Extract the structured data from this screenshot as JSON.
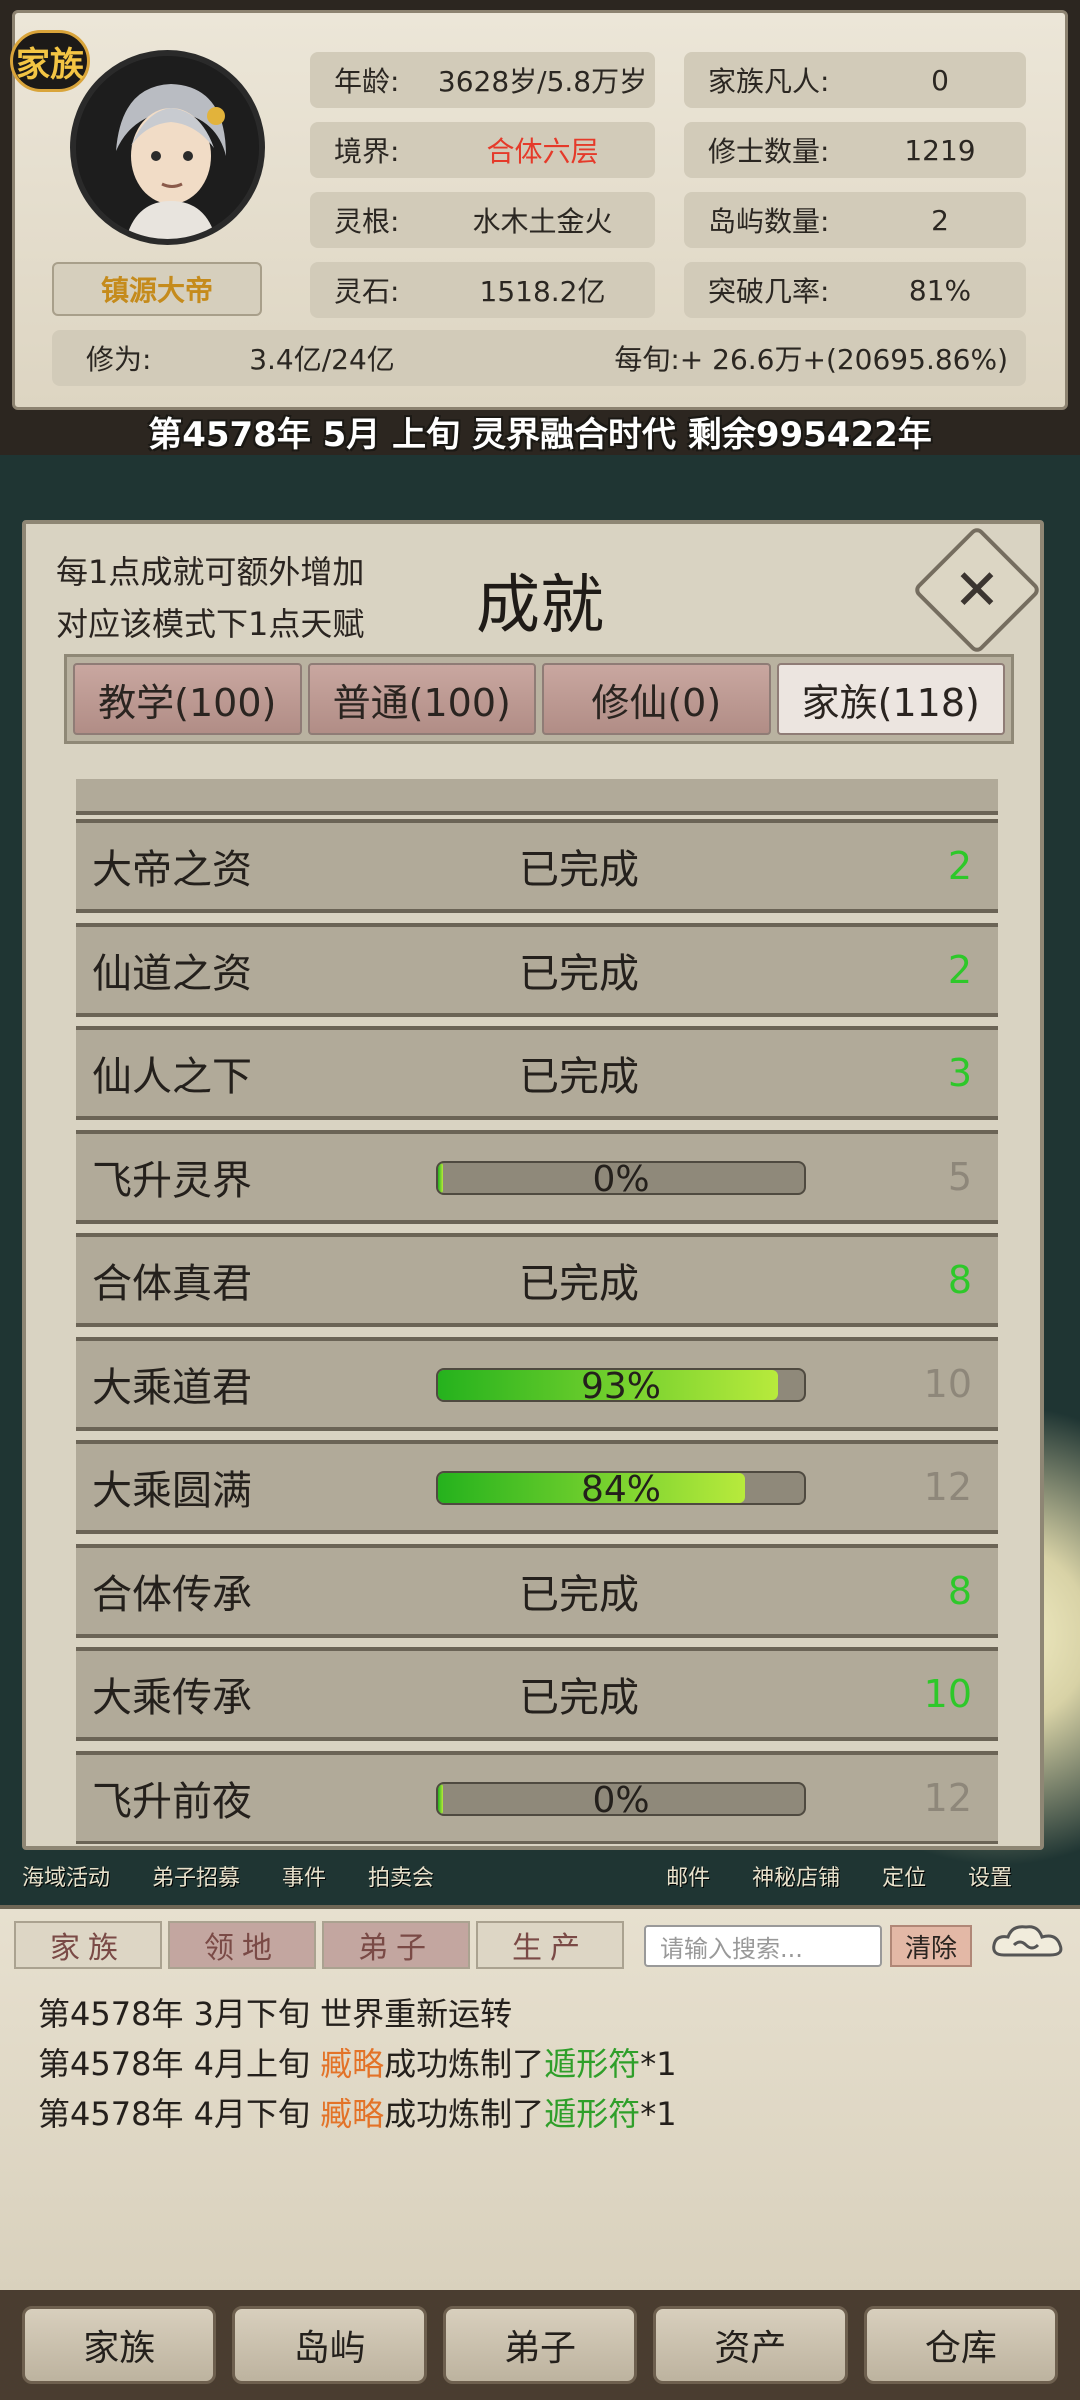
{
  "header": {
    "family_badge": "家族",
    "player_title": "镇源大帝",
    "stats_left": [
      {
        "label": "年龄:",
        "value": "3628岁/5.8万岁"
      },
      {
        "label": "境界:",
        "value": "合体六层"
      },
      {
        "label": "灵根:",
        "value": "水木土金火"
      },
      {
        "label": "灵石:",
        "value": "1518.2亿"
      }
    ],
    "stats_right": [
      {
        "label": "家族凡人:",
        "value": "0"
      },
      {
        "label": "修士数量:",
        "value": "1219"
      },
      {
        "label": "岛屿数量:",
        "value": "2"
      },
      {
        "label": "突破几率:",
        "value": "81%"
      }
    ],
    "cultivation_label": "修为:",
    "cultivation_value": "3.4亿/24亿",
    "per_period": "每旬:+ 26.6万+(20695.86%)",
    "realm_color": "#e53a2a",
    "year_line": "第4578年 5月 上旬  灵界融合时代 剩余995422年"
  },
  "dialog": {
    "hint_line1": "每1点成就可额外增加",
    "hint_line2": "对应该模式下1点天赋",
    "title": "成就",
    "tabs": [
      {
        "label": "教学(100)",
        "active": false
      },
      {
        "label": "普通(100)",
        "active": false
      },
      {
        "label": "修仙(0)",
        "active": false
      },
      {
        "label": "家族(118)",
        "active": true
      }
    ],
    "achievements": [
      {
        "name": "大帝之资",
        "status": "已完成",
        "progress": null,
        "points": "2",
        "done": true
      },
      {
        "name": "仙道之资",
        "status": "已完成",
        "progress": null,
        "points": "2",
        "done": true
      },
      {
        "name": "仙人之下",
        "status": "已完成",
        "progress": null,
        "points": "3",
        "done": true
      },
      {
        "name": "飞升灵界",
        "status": "0%",
        "progress": 0,
        "points": "5",
        "done": false
      },
      {
        "name": "合体真君",
        "status": "已完成",
        "progress": null,
        "points": "8",
        "done": true
      },
      {
        "name": "大乘道君",
        "status": "93%",
        "progress": 93,
        "points": "10",
        "done": false
      },
      {
        "name": "大乘圆满",
        "status": "84%",
        "progress": 84,
        "points": "12",
        "done": false
      },
      {
        "name": "合体传承",
        "status": "已完成",
        "progress": null,
        "points": "8",
        "done": true
      },
      {
        "name": "大乘传承",
        "status": "已完成",
        "progress": null,
        "points": "10",
        "done": true
      },
      {
        "name": "飞升前夜",
        "status": "0%",
        "progress": 0,
        "points": "12",
        "done": false
      }
    ]
  },
  "menu_strip": [
    "海域活动",
    "弟子招募",
    "事件",
    "拍卖会",
    "邮件",
    "神秘店铺",
    "定位",
    "设置"
  ],
  "log_panel": {
    "tabs": [
      "家族",
      "领地",
      "弟子",
      "生产"
    ],
    "search_placeholder": "请输入搜索...",
    "clear_label": "清除",
    "entries": [
      {
        "time": "第4578年 3月下旬 ",
        "text1": "世界重新运转",
        "actor": "",
        "text2": "",
        "item": "",
        "qty": ""
      },
      {
        "time": "第4578年 4月上旬 ",
        "text1": "",
        "actor": "臧略",
        "text2": "成功炼制了",
        "item": "遁形符",
        "qty": "*1"
      },
      {
        "time": "第4578年 4月下旬 ",
        "text1": "",
        "actor": "臧略",
        "text2": "成功炼制了",
        "item": "遁形符",
        "qty": "*1"
      }
    ]
  },
  "bottom_nav": [
    "家族",
    "岛屿",
    "弟子",
    "资产",
    "仓库"
  ]
}
